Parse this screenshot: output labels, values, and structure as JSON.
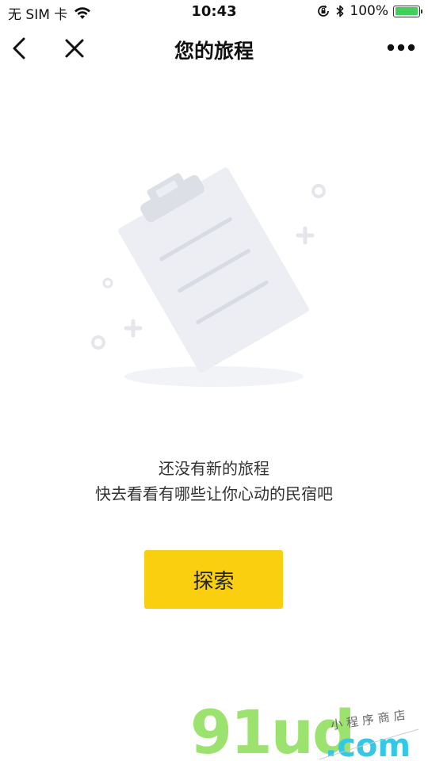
{
  "status_bar": {
    "carrier": "无 SIM 卡",
    "time": "10:43",
    "battery_percent": "100%",
    "battery_level": 1.0
  },
  "nav": {
    "title": "您的旅程"
  },
  "empty_state": {
    "line1": "还没有新的旅程",
    "line2": "快去看看有哪些让你心动的民宿吧"
  },
  "actions": {
    "explore_label": "探索"
  },
  "watermark": {
    "brand": "91ud",
    "domain": ".com",
    "tagline": "小程序商店"
  },
  "icons": {
    "back": "chevron-left-icon",
    "close": "close-icon",
    "more": "more-dots-icon",
    "wifi": "wifi-icon",
    "orientation_lock": "orientation-lock-icon",
    "bluetooth": "bluetooth-icon",
    "battery": "battery-icon"
  },
  "colors": {
    "accent": "#f9cf10",
    "battery": "#3fd159",
    "watermark_green": "#9be26e",
    "watermark_cyan": "#33c9e6"
  }
}
